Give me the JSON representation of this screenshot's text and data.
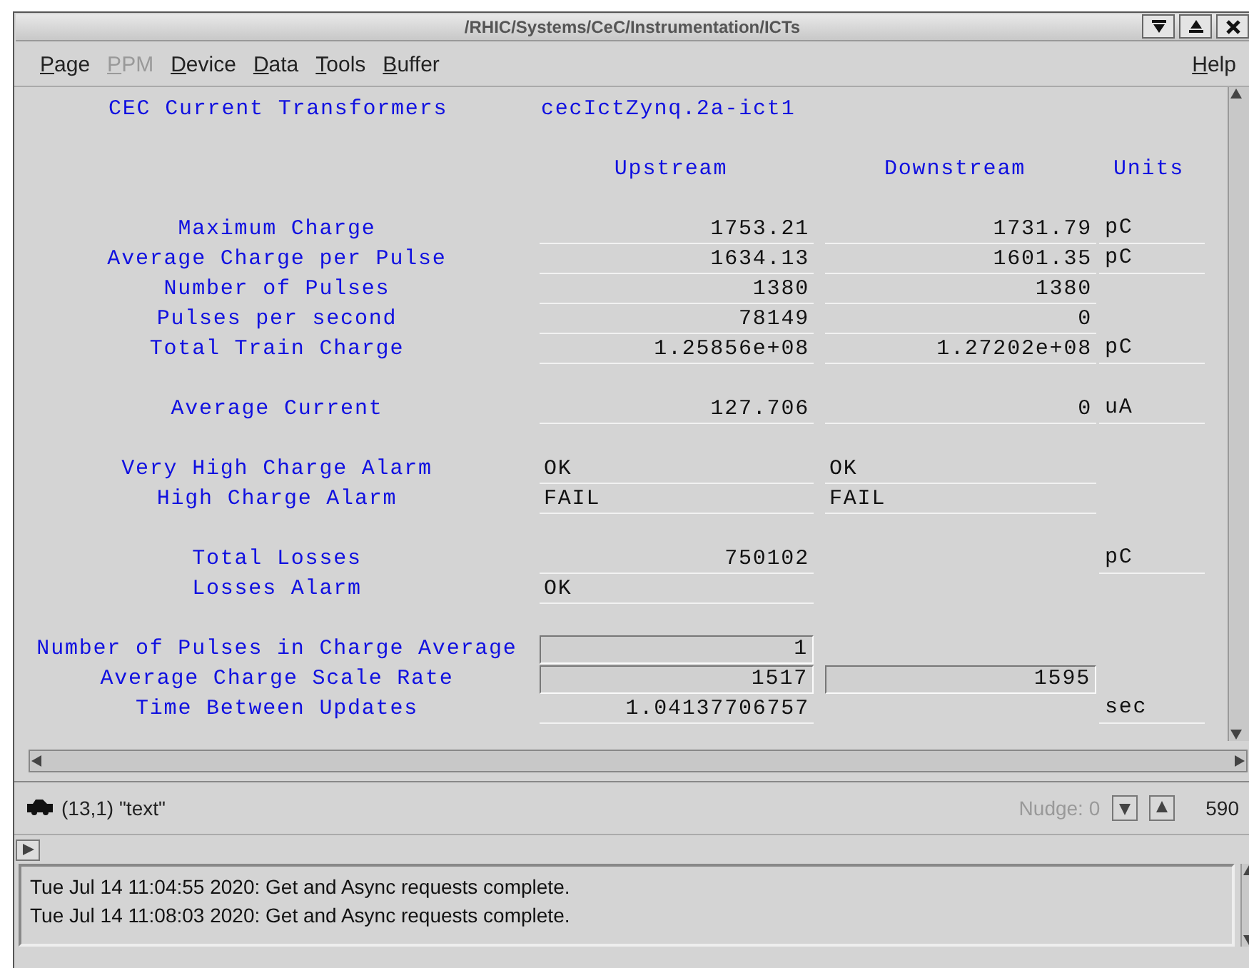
{
  "window": {
    "title": "/RHIC/Systems/CeC/Instrumentation/ICTs"
  },
  "menu": [
    {
      "label": "Page",
      "disabled": false
    },
    {
      "label": "PPM",
      "disabled": true
    },
    {
      "label": "Device",
      "disabled": false
    },
    {
      "label": "Data",
      "disabled": false
    },
    {
      "label": "Tools",
      "disabled": false
    },
    {
      "label": "Buffer",
      "disabled": false
    }
  ],
  "help": "Help",
  "panel": {
    "title": "CEC Current Transformers",
    "device": "cecIctZynq.2a-ict1",
    "columns": [
      "Upstream",
      "Downstream",
      "Units"
    ],
    "groups": [
      [
        {
          "label": "Maximum Charge",
          "kind": "number",
          "upstream": "1753.21",
          "downstream": "1731.79",
          "unit": "pC"
        },
        {
          "label": "Average Charge per Pulse",
          "kind": "number",
          "upstream": "1634.13",
          "downstream": "1601.35",
          "unit": "pC"
        },
        {
          "label": "Number of Pulses",
          "kind": "number",
          "upstream": "1380",
          "downstream": "1380"
        },
        {
          "label": "Pulses per second",
          "kind": "number",
          "upstream": "78149",
          "downstream": "0"
        },
        {
          "label": "Total Train Charge",
          "kind": "number",
          "upstream": "1.25856e+08",
          "downstream": "1.27202e+08",
          "unit": "pC"
        }
      ],
      [
        {
          "label": "Average Current",
          "kind": "number",
          "upstream": "127.706",
          "downstream": "0",
          "unit": "uA"
        }
      ],
      [
        {
          "label": "Very High Charge Alarm",
          "kind": "status",
          "upstream": "OK",
          "downstream": "OK"
        },
        {
          "label": "High Charge Alarm",
          "kind": "status",
          "upstream": "FAIL",
          "downstream": "FAIL"
        }
      ],
      [
        {
          "label": "Total Losses",
          "kind": "number",
          "upstream": "750102",
          "unit": "pC"
        },
        {
          "label": "Losses Alarm",
          "kind": "status",
          "upstream": "OK"
        }
      ],
      [
        {
          "label": "Number of Pulses in Charge Average",
          "kind": "field",
          "upstream": "1"
        },
        {
          "label": "Average Charge Scale Rate",
          "kind": "field",
          "upstream": "1517",
          "downstream": "1595"
        },
        {
          "label": "Time Between Updates",
          "kind": "number",
          "upstream": "1.04137706757",
          "unit": "sec"
        }
      ]
    ]
  },
  "status": {
    "cursor": "(13,1) \"text\"",
    "nudge_label": "Nudge:",
    "nudge_value": "0",
    "count": "590"
  },
  "log": [
    "Tue Jul 14 11:04:55 2020: Get and Async requests complete.",
    "Tue Jul 14 11:08:03 2020: Get and Async requests complete."
  ]
}
